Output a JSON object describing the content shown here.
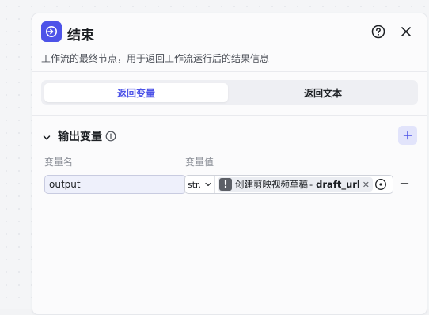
{
  "node": {
    "title": "结束",
    "icon": "end-node-icon",
    "description": "工作流的最终节点，用于返回工作流运行后的结果信息",
    "accent_color": "#4d53e8"
  },
  "header": {
    "help_icon": "help-circle-icon",
    "close_icon": "close-icon"
  },
  "mode_tabs": [
    {
      "label": "返回变量",
      "active": true
    },
    {
      "label": "返回文本",
      "active": false
    }
  ],
  "output_section": {
    "title": "输出变量",
    "info_icon": "info-icon",
    "add_icon": "plus-icon",
    "columns": {
      "name": "变量名",
      "value": "变量值"
    },
    "rows": [
      {
        "name": "output",
        "type": "str.",
        "ref_node": "创建剪映视频草稿",
        "ref_sep": "-",
        "ref_var": "draft_url",
        "remove_icon": "minus-icon"
      }
    ]
  }
}
